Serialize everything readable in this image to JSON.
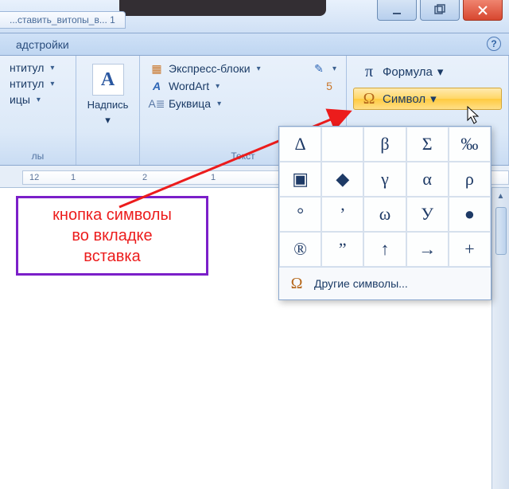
{
  "titlebar": {
    "doc_tab": "...ставить_витопы_в... 1"
  },
  "window_buttons": {
    "minimize": "minimize",
    "maximize": "maximize",
    "close": "close"
  },
  "tabs": {
    "active": "адстройки"
  },
  "help": "?",
  "ribbon": {
    "group_header": {
      "items": [
        "нтитул",
        "нтитул",
        "ицы"
      ],
      "label": "лы"
    },
    "group_textbox": {
      "button": "Надпись"
    },
    "group_text": {
      "express_blocks": "Экспресс-блоки",
      "wordart": "WordArt",
      "dropcap": "Буквица",
      "label": "Текст"
    },
    "group_symbols": {
      "equation": "Формула",
      "symbol": "Символ"
    }
  },
  "ruler": {
    "marks": [
      "12",
      "1",
      "2",
      "1"
    ]
  },
  "symbol_panel": {
    "grid": [
      "Δ",
      "",
      "β",
      "Σ",
      "‰",
      "▣",
      "◆",
      "γ",
      "α",
      "ρ",
      "°",
      "’",
      "ω",
      "У",
      "●",
      "®",
      "”",
      "↑",
      "→",
      "+"
    ],
    "more": "Другие символы..."
  },
  "callout": {
    "line1": "кнопка символы",
    "line2": "во вкладке",
    "line3": "вставка"
  }
}
